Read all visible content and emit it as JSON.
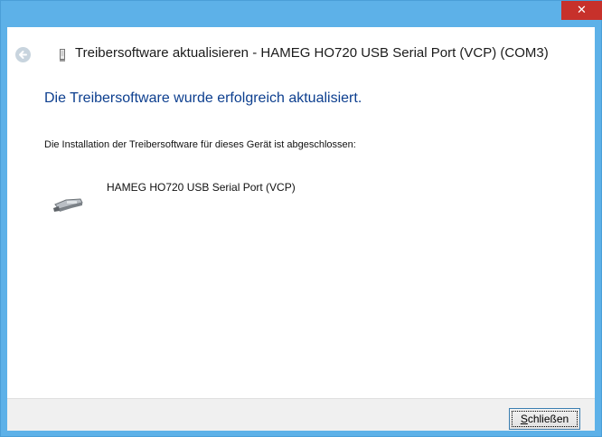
{
  "window": {
    "title": "Treibersoftware aktualisieren - HAMEG HO720 USB Serial Port (VCP) (COM3)",
    "close_glyph": "✕"
  },
  "content": {
    "headline": "Die Treibersoftware wurde erfolgreich aktualisiert.",
    "info": "Die Installation der Treibersoftware für dieses Gerät ist abgeschlossen:",
    "device_name": "HAMEG HO720 USB Serial Port (VCP)",
    "device_icon": "serial-port-icon"
  },
  "footer": {
    "close_label_first": "S",
    "close_label_rest": "chließen"
  },
  "colors": {
    "frame": "#5db1e8",
    "close_red": "#c7312b",
    "headline_blue": "#0d3f8f",
    "footer_bg": "#f0f0f0"
  }
}
